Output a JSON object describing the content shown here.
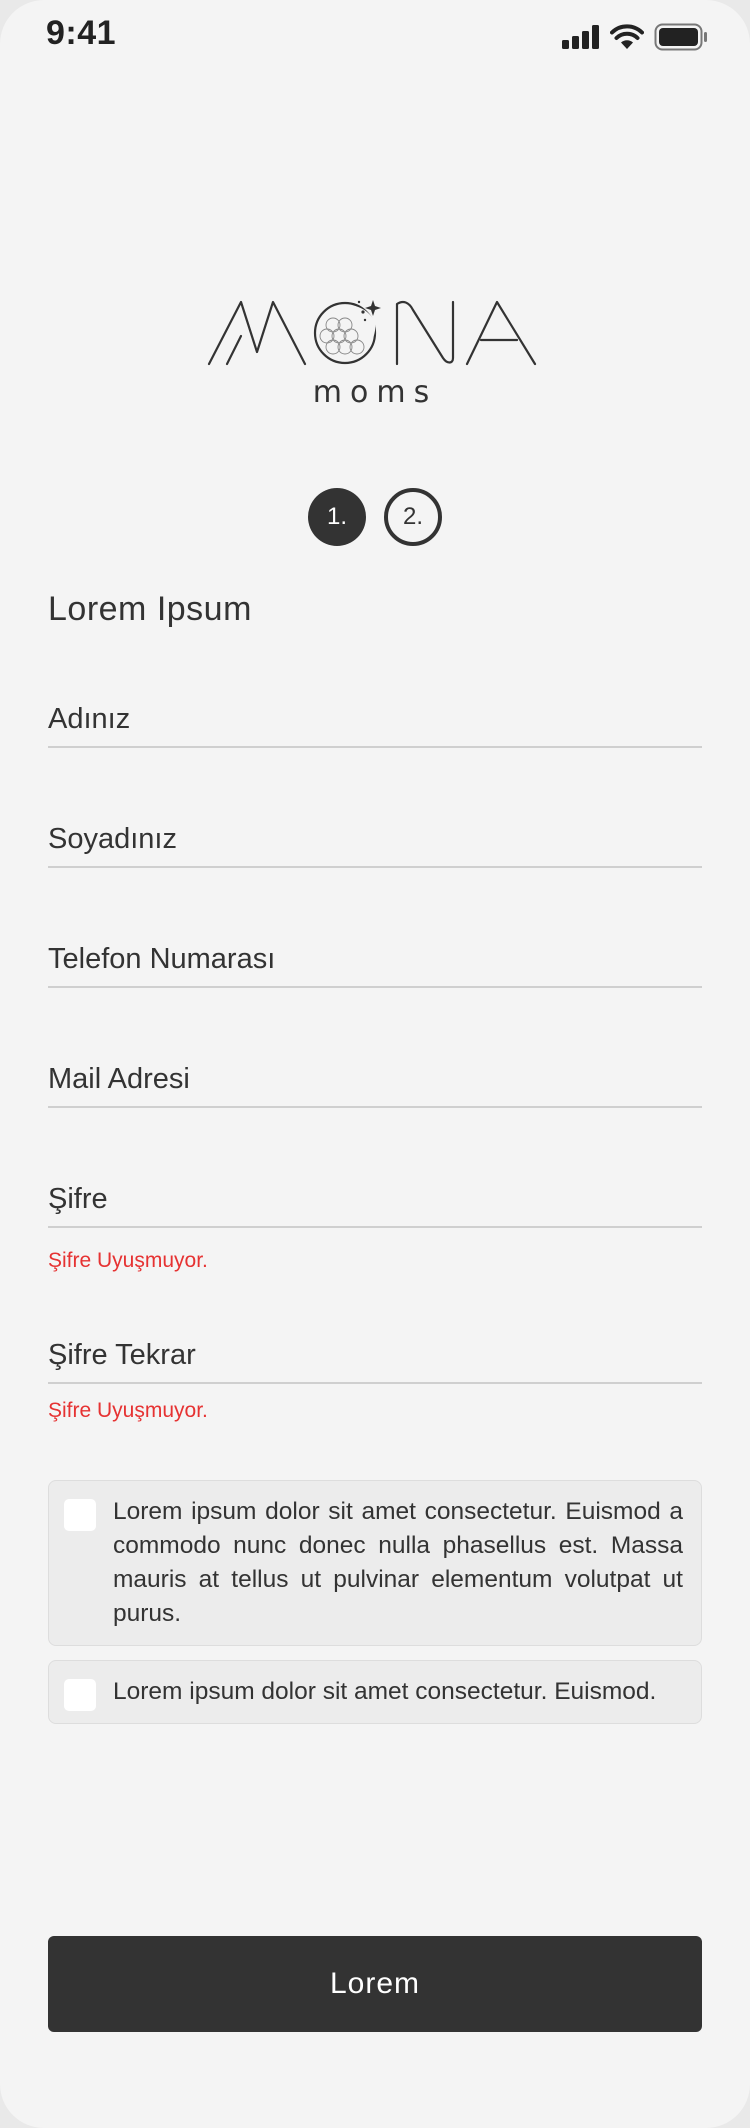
{
  "status_bar": {
    "time": "9:41",
    "icons": [
      "signal-icon",
      "wifi-icon",
      "battery-icon"
    ]
  },
  "logo": {
    "brand": "MONA",
    "subtitle": "moms"
  },
  "steps": [
    {
      "label": "1.",
      "active": true
    },
    {
      "label": "2.",
      "active": false
    }
  ],
  "form": {
    "heading": "Lorem Ipsum",
    "fields": {
      "first_name": {
        "placeholder": "Adınız",
        "value": ""
      },
      "last_name": {
        "placeholder": "Soyadınız",
        "value": ""
      },
      "phone": {
        "placeholder": "Telefon Numarası",
        "value": ""
      },
      "email": {
        "placeholder": "Mail Adresi",
        "value": ""
      },
      "password": {
        "placeholder": "Şifre",
        "value": "",
        "error": "Şifre Uyuşmuyor."
      },
      "password_repeat": {
        "placeholder": "Şifre Tekrar",
        "value": "",
        "error": "Şifre Uyuşmuyor."
      }
    },
    "consents": [
      {
        "text": "Lorem ipsum dolor sit amet consectetur. Euismod a commodo nunc donec nulla phasellus est. Massa mauris at tellus ut pulvinar elementum volutpat ut purus.",
        "checked": false
      },
      {
        "text": "Lorem ipsum dolor sit amet consectetur. Euismod.",
        "checked": false
      }
    ],
    "submit_label": "Lorem"
  },
  "colors": {
    "background": "#f4f4f4",
    "primary": "#333333",
    "error": "#e63232",
    "consent_bg": "#ececec"
  }
}
